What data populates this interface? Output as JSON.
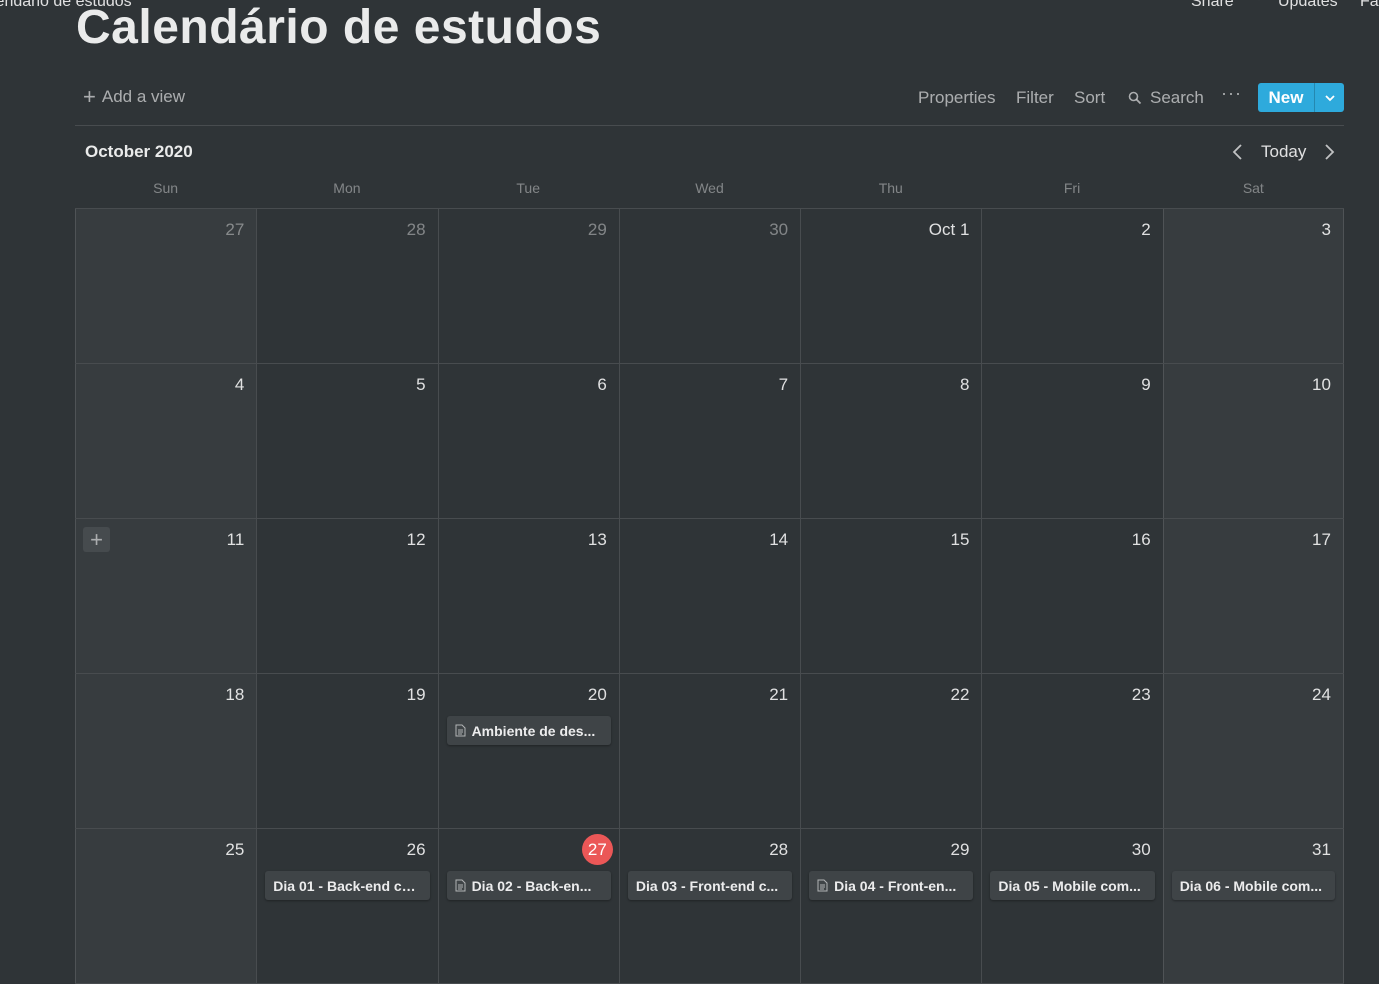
{
  "topbar": {
    "breadcrumb": "lendário de estudos",
    "share": "Share",
    "updates": "Updates",
    "favorite": "Fa"
  },
  "page": {
    "title": "Calendário de estudos"
  },
  "toolbar": {
    "add_view": "Add a view",
    "properties": "Properties",
    "filter": "Filter",
    "sort": "Sort",
    "search": "Search",
    "more": "···",
    "new": "New"
  },
  "calendar": {
    "month": "October 2020",
    "today": "Today",
    "weekdays": [
      "Sun",
      "Mon",
      "Tue",
      "Wed",
      "Thu",
      "Fri",
      "Sat"
    ],
    "weeks": [
      [
        {
          "d": "27",
          "muted": true
        },
        {
          "d": "28",
          "muted": true
        },
        {
          "d": "29",
          "muted": true
        },
        {
          "d": "30",
          "muted": true
        },
        {
          "d": "Oct 1"
        },
        {
          "d": "2"
        },
        {
          "d": "3"
        }
      ],
      [
        {
          "d": "4"
        },
        {
          "d": "5"
        },
        {
          "d": "6"
        },
        {
          "d": "7"
        },
        {
          "d": "8"
        },
        {
          "d": "9"
        },
        {
          "d": "10"
        }
      ],
      [
        {
          "d": "11",
          "add": true
        },
        {
          "d": "12"
        },
        {
          "d": "13"
        },
        {
          "d": "14"
        },
        {
          "d": "15"
        },
        {
          "d": "16"
        },
        {
          "d": "17"
        }
      ],
      [
        {
          "d": "18"
        },
        {
          "d": "19"
        },
        {
          "d": "20",
          "event": "Ambiente de des...",
          "doc": true
        },
        {
          "d": "21"
        },
        {
          "d": "22"
        },
        {
          "d": "23"
        },
        {
          "d": "24"
        }
      ],
      [
        {
          "d": "25"
        },
        {
          "d": "26",
          "event": "Dia 01 - Back-end co..."
        },
        {
          "d": "27",
          "today": true,
          "event": "Dia 02 - Back-en...",
          "doc": true
        },
        {
          "d": "28",
          "event": "Dia 03 - Front-end c..."
        },
        {
          "d": "29",
          "event": "Dia 04 - Front-en...",
          "doc": true
        },
        {
          "d": "30",
          "event": "Dia 05 - Mobile com..."
        },
        {
          "d": "31",
          "event": "Dia 06 - Mobile com..."
        }
      ]
    ]
  },
  "colors": {
    "background": "#2f3437",
    "accent": "#2eaadc",
    "today": "#eb5757"
  }
}
